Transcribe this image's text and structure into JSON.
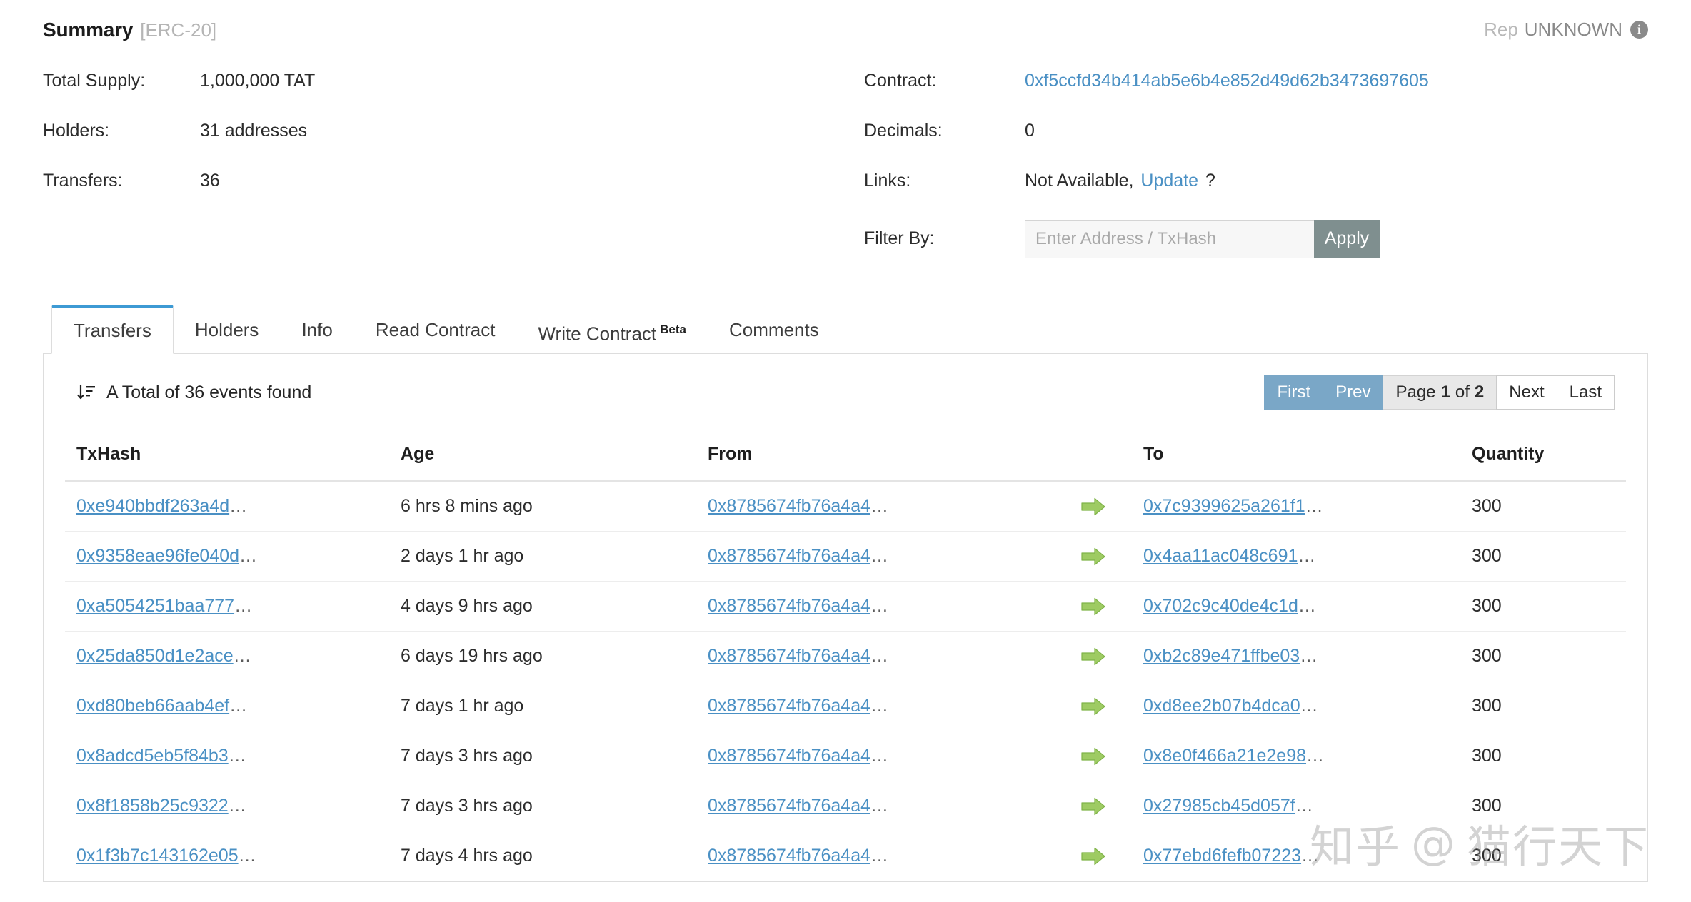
{
  "summary": {
    "title": "Summary",
    "standard": "[ERC-20]",
    "rep_label": "Rep",
    "rep_value": "UNKNOWN",
    "info_icon": "info-icon",
    "left_rows": [
      {
        "label": "Total Supply:",
        "value": "1,000,000 TAT"
      },
      {
        "label": "Holders:",
        "value": "31 addresses"
      },
      {
        "label": "Transfers:",
        "value": "36"
      }
    ],
    "contract_label": "Contract:",
    "contract_value": "0xf5ccfd34b414ab5e6b4e852d49d62b3473697605",
    "decimals_label": "Decimals:",
    "decimals_value": "0",
    "links_label": "Links:",
    "links_value": "Not Available,",
    "links_update": "Update",
    "links_question": "?",
    "filter_label": "Filter By:",
    "filter_placeholder": "Enter Address / TxHash",
    "filter_value": "",
    "apply_label": "Apply"
  },
  "tabs": [
    {
      "label": "Transfers",
      "active": true
    },
    {
      "label": "Holders",
      "active": false
    },
    {
      "label": "Info",
      "active": false
    },
    {
      "label": "Read Contract",
      "active": false
    },
    {
      "label": "Write Contract",
      "badge": "Beta",
      "active": false
    },
    {
      "label": "Comments",
      "active": false
    }
  ],
  "panel": {
    "events_found": "A Total of 36 events found",
    "sort_icon": "sort-descending-icon",
    "pagination": {
      "first": "First",
      "prev": "Prev",
      "page_prefix": "Page",
      "page_current": "1",
      "page_of": "of",
      "page_total": "2",
      "next": "Next",
      "last": "Last"
    }
  },
  "table": {
    "columns": [
      "TxHash",
      "Age",
      "From",
      "",
      "To",
      "Quantity"
    ],
    "rows": [
      {
        "txhash": "0xe940bbdf263a4d",
        "age": "6 hrs 8 mins ago",
        "from": "0x8785674fb76a4a4",
        "arrow": "transfer-arrow-icon",
        "to": "0x7c9399625a261f1",
        "quantity": "300"
      },
      {
        "txhash": "0x9358eae96fe040d",
        "age": "2 days 1 hr ago",
        "from": "0x8785674fb76a4a4",
        "arrow": "transfer-arrow-icon",
        "to": "0x4aa11ac048c691",
        "quantity": "300"
      },
      {
        "txhash": "0xa5054251baa777",
        "age": "4 days 9 hrs ago",
        "from": "0x8785674fb76a4a4",
        "arrow": "transfer-arrow-icon",
        "to": "0x702c9c40de4c1d",
        "quantity": "300"
      },
      {
        "txhash": "0x25da850d1e2ace",
        "age": "6 days 19 hrs ago",
        "from": "0x8785674fb76a4a4",
        "arrow": "transfer-arrow-icon",
        "to": "0xb2c89e471ffbe03",
        "quantity": "300"
      },
      {
        "txhash": "0xd80beb66aab4ef",
        "age": "7 days 1 hr ago",
        "from": "0x8785674fb76a4a4",
        "arrow": "transfer-arrow-icon",
        "to": "0xd8ee2b07b4dca0",
        "quantity": "300"
      },
      {
        "txhash": "0x8adcd5eb5f84b3",
        "age": "7 days 3 hrs ago",
        "from": "0x8785674fb76a4a4",
        "arrow": "transfer-arrow-icon",
        "to": "0x8e0f466a21e2e98",
        "quantity": "300"
      },
      {
        "txhash": "0x8f1858b25c9322",
        "age": "7 days 3 hrs ago",
        "from": "0x8785674fb76a4a4",
        "arrow": "transfer-arrow-icon",
        "to": "0x27985cb45d057f",
        "quantity": "300"
      },
      {
        "txhash": "0x1f3b7c143162e05",
        "age": "7 days 4 hrs ago",
        "from": "0x8785674fb76a4a4",
        "arrow": "transfer-arrow-icon",
        "to": "0x77ebd6fefb07223",
        "quantity": "300"
      }
    ],
    "truncation": "…"
  },
  "watermark": {
    "site": "知乎",
    "at": "@",
    "user": "猫行天下"
  },
  "colors": {
    "link": "#4a90c4",
    "tab_active_border": "#3d9ad4",
    "pager_active": "#7aa7c7",
    "apply_button": "#7f8f8f",
    "arrow_green": "#8fc45a"
  }
}
